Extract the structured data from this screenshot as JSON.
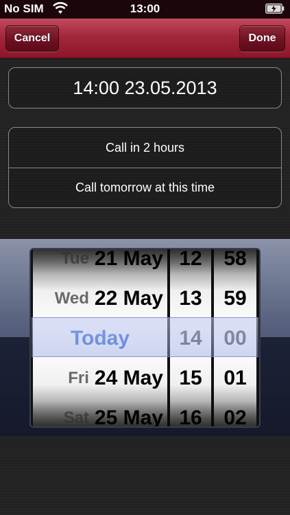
{
  "status_bar": {
    "carrier": "No SIM",
    "time": "13:00",
    "wifi_icon": "wifi-icon",
    "battery_icon": "battery-charging-icon"
  },
  "navbar": {
    "cancel_label": "Cancel",
    "done_label": "Done"
  },
  "selected_datetime": "14:00 23.05.2013",
  "quick_options": [
    "Call in 2 hours",
    "Call tomorrow at this time"
  ],
  "picker": {
    "dates": [
      {
        "dow": "Tue",
        "date": "21 May"
      },
      {
        "dow": "Wed",
        "date": "22 May"
      },
      {
        "dow": "",
        "date": "Today"
      },
      {
        "dow": "Fri",
        "date": "24 May"
      },
      {
        "dow": "Sat",
        "date": "25 May"
      }
    ],
    "hours": [
      "12",
      "13",
      "14",
      "15",
      "16"
    ],
    "minutes": [
      "58",
      "59",
      "00",
      "01",
      "02"
    ]
  },
  "colors": {
    "nav_accent": "#a3273b",
    "today_text": "#3a6fd8"
  }
}
